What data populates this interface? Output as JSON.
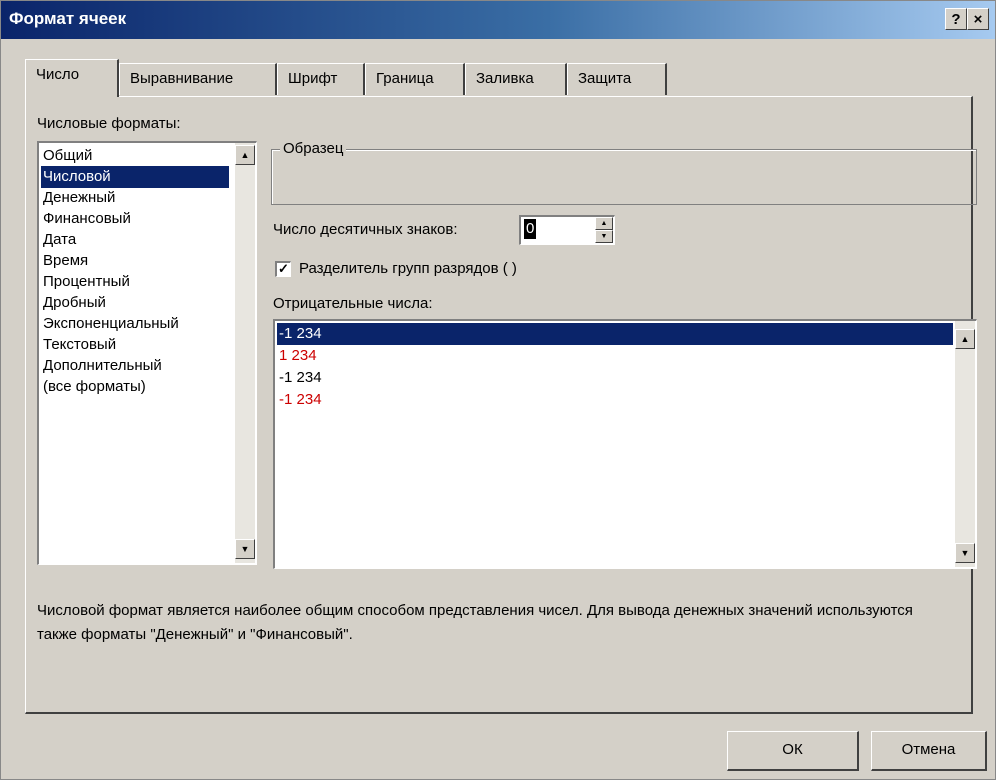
{
  "window": {
    "title": "Формат ячеек",
    "help_button": "?",
    "close_button": "×"
  },
  "tabs": [
    {
      "label": "Число",
      "active": true
    },
    {
      "label": "Выравнивание",
      "active": false
    },
    {
      "label": "Шрифт",
      "active": false
    },
    {
      "label": "Граница",
      "active": false
    },
    {
      "label": "Заливка",
      "active": false
    },
    {
      "label": "Защита",
      "active": false
    }
  ],
  "number_formats": {
    "label": "Числовые форматы:",
    "items": [
      "Общий",
      "Числовой",
      "Денежный",
      "Финансовый",
      "Дата",
      "Время",
      "Процентный",
      "Дробный",
      "Экспоненциальный",
      "Текстовый",
      "Дополнительный",
      "(все форматы)"
    ],
    "selected": "Числовой"
  },
  "sample": {
    "legend": "Образец",
    "value": ""
  },
  "decimal_places": {
    "label": "Число десятичных знаков:",
    "value": "0"
  },
  "separator": {
    "label": "Разделитель групп разрядов ( )",
    "checked": true,
    "check_glyph": "✓"
  },
  "negative_numbers": {
    "label": "Отрицательные числа:",
    "items": [
      {
        "text": "-1 234",
        "color": "#000000",
        "selected": true
      },
      {
        "text": "1 234",
        "color": "#cc0000",
        "selected": false
      },
      {
        "text": "-1 234",
        "color": "#000000",
        "selected": false
      },
      {
        "text": "-1 234",
        "color": "#cc0000",
        "selected": false
      }
    ]
  },
  "scroll_arrows": {
    "up": "▲",
    "down": "▼"
  },
  "description": "Числовой формат является наиболее общим способом представления чисел. Для вывода денежных значений используются также форматы \"Денежный\" и \"Финансовый\".",
  "buttons": {
    "ok": "ОК",
    "cancel": "Отмена"
  },
  "colors": {
    "selection": "#0a246a",
    "negative_red": "#cc0000",
    "dialog_bg": "#d4d0c8"
  }
}
